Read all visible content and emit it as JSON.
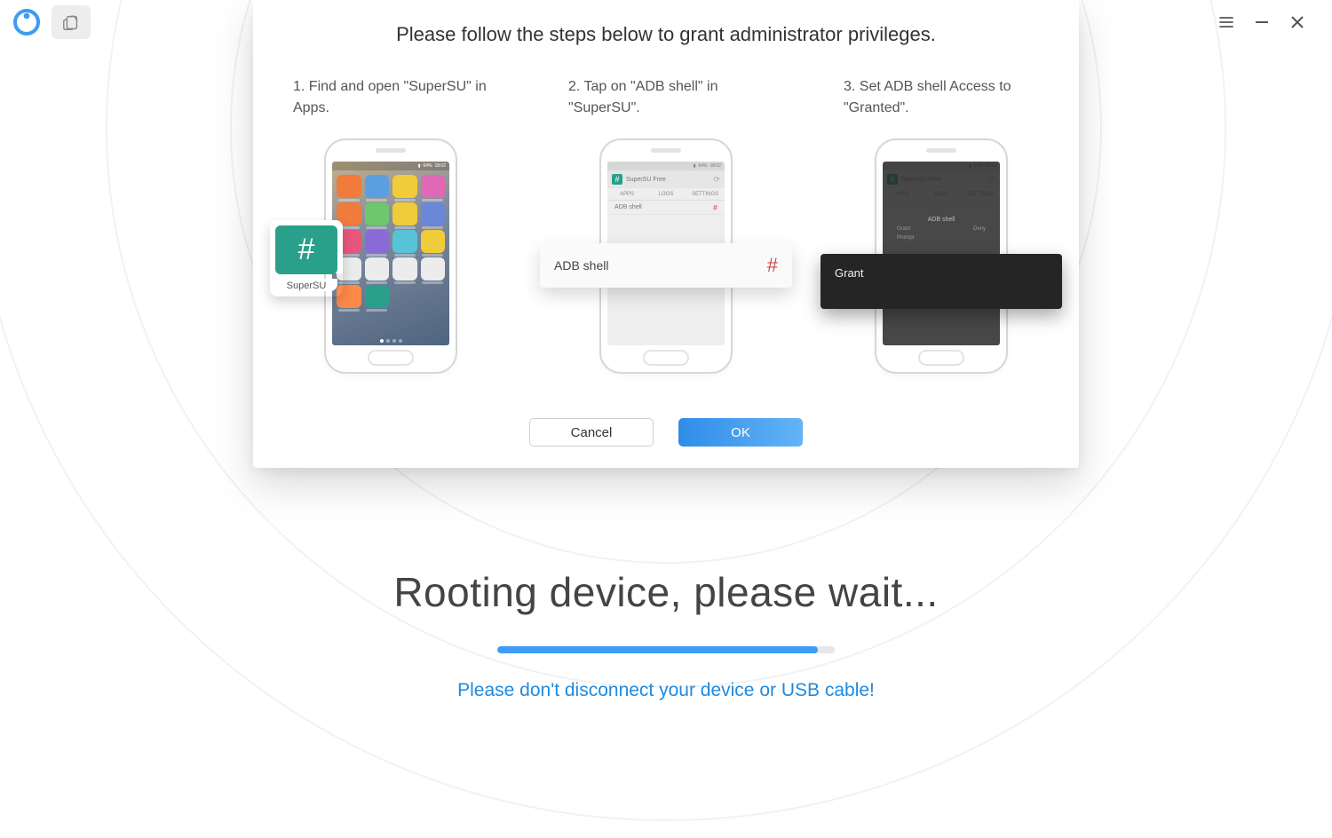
{
  "colors": {
    "accent": "#3d9cf4",
    "teal": "#2aa08a",
    "warn": "#cc4a4a"
  },
  "titlebar": {
    "logo_name": "phonerescue-logo",
    "toolbar_button_name": "copy-clipboard",
    "menu_name": "menu",
    "minimize_name": "minimize",
    "close_name": "close"
  },
  "status": {
    "title": "Rooting device, please wait...",
    "progress_percent": 95,
    "warning": "Please don't disconnect your device or USB cable!"
  },
  "modal": {
    "title": "Please follow the steps below to grant administrator privileges.",
    "steps": [
      {
        "text": "1. Find and open \"SuperSU\" in Apps.",
        "callout_label": "SuperSU",
        "callout_symbol": "#"
      },
      {
        "text": "2. Tap on \"ADB shell\" in \"SuperSU\".",
        "app_title": "SuperSU Free",
        "tabs": [
          "APPS",
          "LOGS",
          "SETTINGS"
        ],
        "row_label": "ADB shell",
        "card_label": "ADB shell",
        "card_symbol": "#"
      },
      {
        "text": "3. Set ADB shell Access to \"Granted\".",
        "app_title": "SuperSU Free",
        "tabs": [
          "APPS",
          "LOGS",
          "SETTINGS"
        ],
        "overlay_title": "ADB shell",
        "overlay_rows": [
          [
            "Grant",
            "Deny"
          ],
          [
            "Prompt",
            ""
          ]
        ],
        "card_label": "Grant"
      }
    ],
    "buttons": {
      "cancel": "Cancel",
      "ok": "OK"
    }
  },
  "phone_status_bar": {
    "battery": "64%",
    "time": "18:02"
  }
}
